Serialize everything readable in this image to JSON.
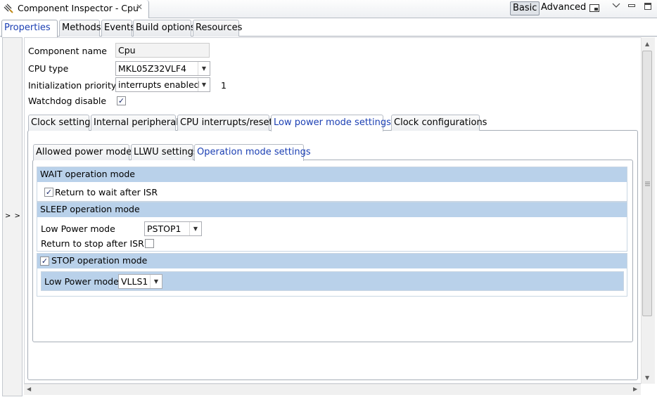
{
  "view": {
    "title": "Component Inspector - Cpu",
    "close_glyph": "✕",
    "mode_basic": "Basic",
    "mode_advanced": "Advanced"
  },
  "main_tabs": [
    "Properties",
    "Methods",
    "Events",
    "Build options",
    "Resources"
  ],
  "side": {
    "toggle": "> >"
  },
  "props": {
    "component_name_label": "Component name",
    "component_name_value": "Cpu",
    "cpu_type_label": "CPU type",
    "cpu_type_value": "MKL05Z32VLF4",
    "init_priority_label": "Initialization priority",
    "init_priority_value": "interrupts enabled",
    "init_priority_extra": "1",
    "watchdog_label": "Watchdog disable",
    "watchdog_checked": true
  },
  "settings_tabs": [
    "Clock settings",
    "Internal peripherals",
    "CPU interrupts/resets",
    "Low power mode settings",
    "Clock configurations"
  ],
  "power_tabs": [
    "Allowed power modes",
    "LLWU settings",
    "Operation mode settings"
  ],
  "wait": {
    "header": "WAIT operation mode",
    "return_label": "Return to wait after ISR",
    "return_checked": true
  },
  "sleep": {
    "header": "SLEEP operation mode",
    "lpm_label": "Low Power mode",
    "lpm_value": "PSTOP1",
    "return_label": "Return to stop after ISR",
    "return_checked": false
  },
  "stop": {
    "header": "STOP operation mode",
    "enabled": true,
    "lpm_label": "Low Power mode",
    "lpm_value": "VLLS1"
  },
  "glyphs": {
    "check": "✓",
    "combo_arrow": "▼"
  },
  "colors": {
    "active_tab_text": "#1b3fb3",
    "section_header": "#b9d1ea"
  }
}
